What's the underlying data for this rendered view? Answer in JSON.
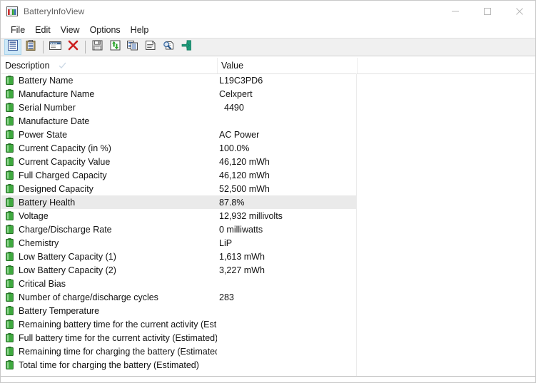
{
  "window": {
    "title": "BatteryInfoView",
    "icon": "battery-info-app-icon",
    "minimize_label": "Minimize",
    "maximize_label": "Maximize",
    "close_label": "Close"
  },
  "menu": {
    "items": [
      {
        "label": "File",
        "name": "menu-file"
      },
      {
        "label": "Edit",
        "name": "menu-edit"
      },
      {
        "label": "View",
        "name": "menu-view"
      },
      {
        "label": "Options",
        "name": "menu-options"
      },
      {
        "label": "Help",
        "name": "menu-help"
      }
    ]
  },
  "toolbar": {
    "buttons": [
      {
        "name": "properties-view-button",
        "icon": "list-view-icon",
        "selected": true
      },
      {
        "name": "clipboard-button",
        "icon": "clipboard-icon",
        "selected": false
      },
      {
        "name": "select-columns-button",
        "icon": "columns-icon",
        "selected": false
      },
      {
        "name": "delete-button",
        "icon": "red-x-icon",
        "selected": false
      },
      {
        "name": "save-button",
        "icon": "floppy-disk-icon",
        "selected": false
      },
      {
        "name": "refresh-button",
        "icon": "refresh-icon",
        "selected": false
      },
      {
        "name": "copy-button",
        "icon": "copy-icon",
        "selected": false
      },
      {
        "name": "properties-button",
        "icon": "properties-icon",
        "selected": false
      },
      {
        "name": "find-button",
        "icon": "magnifier-page-icon",
        "selected": false
      },
      {
        "name": "exit-button",
        "icon": "exit-door-icon",
        "selected": false
      }
    ]
  },
  "list": {
    "columns": [
      {
        "label": "Description",
        "name": "column-header-description",
        "sorted": true,
        "sort_direction": "ascending"
      },
      {
        "label": "Value",
        "name": "column-header-value",
        "sorted": false
      }
    ],
    "rows": [
      {
        "description": "Battery Name",
        "value": "L19C3PD6",
        "selected": false,
        "indent_value": false
      },
      {
        "description": "Manufacture Name",
        "value": "Celxpert",
        "selected": false,
        "indent_value": false
      },
      {
        "description": "Serial Number",
        "value": "4490",
        "selected": false,
        "indent_value": true
      },
      {
        "description": "Manufacture Date",
        "value": "",
        "selected": false,
        "indent_value": false
      },
      {
        "description": "Power State",
        "value": "AC Power",
        "selected": false,
        "indent_value": false
      },
      {
        "description": "Current Capacity (in %)",
        "value": "100.0%",
        "selected": false,
        "indent_value": false
      },
      {
        "description": "Current Capacity Value",
        "value": "46,120 mWh",
        "selected": false,
        "indent_value": false
      },
      {
        "description": "Full Charged Capacity",
        "value": "46,120 mWh",
        "selected": false,
        "indent_value": false
      },
      {
        "description": "Designed Capacity",
        "value": "52,500 mWh",
        "selected": false,
        "indent_value": false
      },
      {
        "description": "Battery Health",
        "value": "87.8%",
        "selected": true,
        "indent_value": false
      },
      {
        "description": "Voltage",
        "value": "12,932 millivolts",
        "selected": false,
        "indent_value": false
      },
      {
        "description": "Charge/Discharge Rate",
        "value": "0 milliwatts",
        "selected": false,
        "indent_value": false
      },
      {
        "description": "Chemistry",
        "value": "LiP",
        "selected": false,
        "indent_value": false
      },
      {
        "description": "Low Battery Capacity (1)",
        "value": "1,613 mWh",
        "selected": false,
        "indent_value": false
      },
      {
        "description": "Low Battery Capacity (2)",
        "value": "3,227 mWh",
        "selected": false,
        "indent_value": false
      },
      {
        "description": "Critical Bias",
        "value": "",
        "selected": false,
        "indent_value": false
      },
      {
        "description": "Number of charge/discharge cycles",
        "value": "283",
        "selected": false,
        "indent_value": false
      },
      {
        "description": "Battery Temperature",
        "value": "",
        "selected": false,
        "indent_value": false
      },
      {
        "description": "Remaining battery time for the current activity (Est...",
        "value": "",
        "selected": false,
        "indent_value": false
      },
      {
        "description": "Full battery time for the current activity (Estimated)",
        "value": "",
        "selected": false,
        "indent_value": false
      },
      {
        "description": "Remaining time for charging the battery (Estimated)",
        "value": "",
        "selected": false,
        "indent_value": false
      },
      {
        "description": "Total  time for charging the battery (Estimated)",
        "value": "",
        "selected": false,
        "indent_value": false
      }
    ]
  },
  "colors": {
    "battery_icon_green": "#3faa3f",
    "selection_row": "#eaeaea",
    "toolbar_background": "#f0f0f0",
    "selected_button": "#cde8f7",
    "text": "#111111",
    "title_text": "#646464"
  }
}
